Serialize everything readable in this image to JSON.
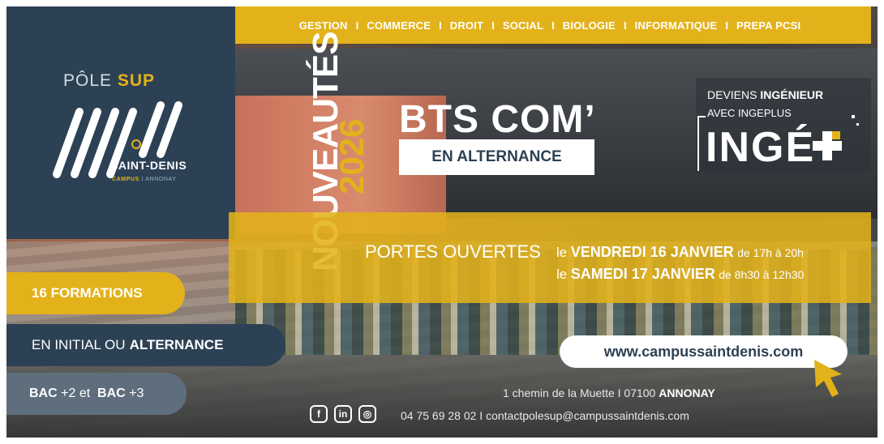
{
  "nav": {
    "items": [
      "GESTION",
      "COMMERCE",
      "DROIT",
      "SOCIAL",
      "BIOLOGIE",
      "INFORMATIQUE",
      "PREPA PCSI"
    ],
    "separator": "I"
  },
  "logo": {
    "pole": "PÔLE",
    "sup": "SUP",
    "name": "SAINT-DENIS",
    "campus": "CAMPUS",
    "campus_sep": "I",
    "city": "ANNONAY"
  },
  "highlight": {
    "nouveautes": "NOUVEAUTÉS",
    "year": "2026"
  },
  "bts": {
    "title": "BTS COM’",
    "subtitle": "EN ALTERNANCE"
  },
  "inge": {
    "line1_a": "DEVIENS",
    "line1_b": "INGÉNIEUR",
    "line2": "AVEC INGEPLUS",
    "logo": "INGÉ"
  },
  "portes": {
    "label": "PORTES OUVERTES",
    "line1_le": "le",
    "line1_day": "VENDREDI 16 JANVIER",
    "line1_hours": "de 17h à 20h",
    "line2_le": "le",
    "line2_day": "SAMEDI 17 JANVIER",
    "line2_hours": "de 8h30 à 12h30"
  },
  "pills": {
    "formations": "16 FORMATIONS",
    "initial": "EN INITIAL OU",
    "alternance": "ALTERNANCE",
    "bac1": "BAC",
    "bac1_level": "+2 et",
    "bac2": "BAC",
    "bac2_level": "+3"
  },
  "web": {
    "url": "www.campussaintdenis.com"
  },
  "contact": {
    "address": "1 chemin de la Muette  I  07100",
    "city": "ANNONAY",
    "phone_email": "04 75 69 28 02  I  contactpolesup@campussaintdenis.com"
  },
  "socials": {
    "facebook": "f",
    "linkedin": "in",
    "instagram": "◎"
  },
  "colors": {
    "navy": "#2c4154",
    "yellow": "#e3b21a",
    "slate": "#5f6e7c"
  }
}
